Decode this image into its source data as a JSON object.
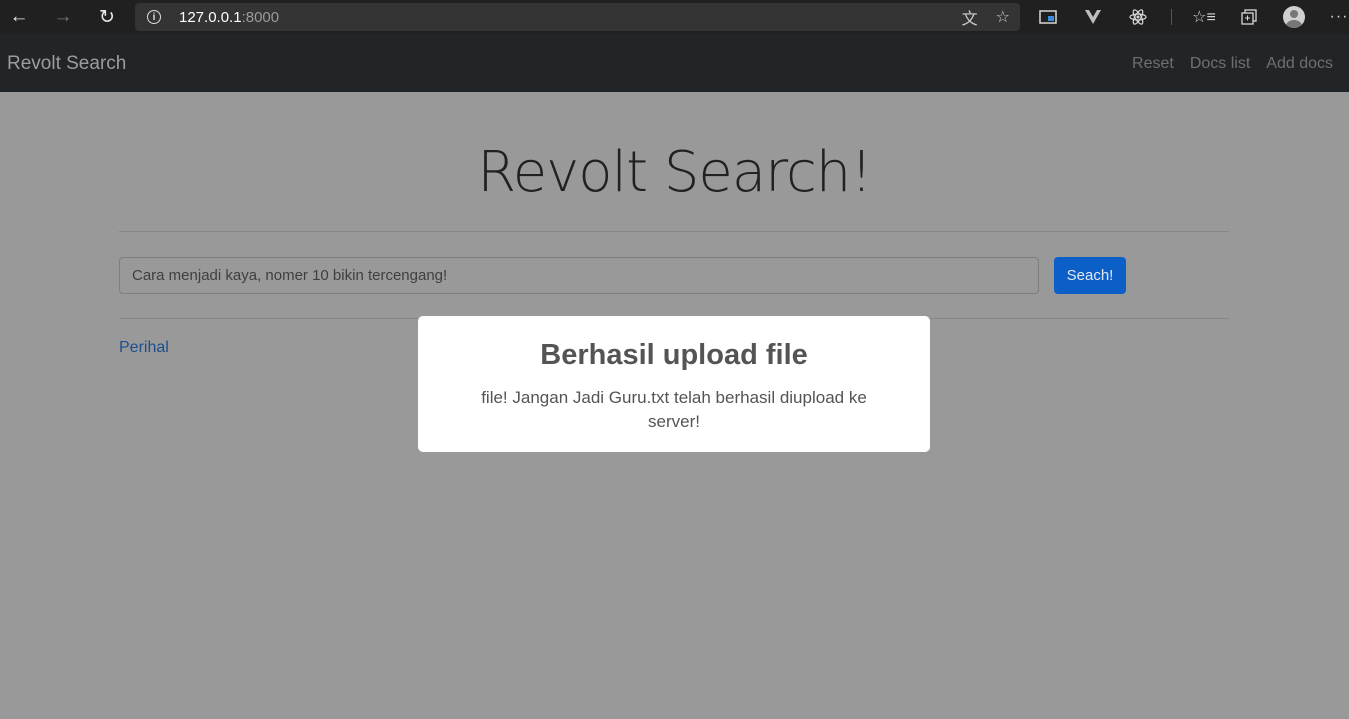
{
  "browser": {
    "url_host": "127.0.0.1",
    "url_port": ":8000",
    "icons": [
      "back-icon",
      "forward-icon",
      "reload-icon",
      "site-info-icon",
      "translate-icon",
      "favorite-star-icon",
      "extension-screen-icon",
      "vue-devtools-icon",
      "react-devtools-icon",
      "favorites-icon",
      "collections-icon",
      "profile-avatar",
      "more-menu-icon"
    ]
  },
  "navbar": {
    "brand": "Revolt Search",
    "links": [
      "Reset",
      "Docs list",
      "Add docs"
    ]
  },
  "main": {
    "title": "Revolt Search!",
    "search_value": "Cara menjadi kaya, nomer 10 bikin tercengang!",
    "search_button": "Seach!",
    "perihal_link": "Perihal"
  },
  "modal": {
    "title": "Berhasil upload file",
    "message": "file! Jangan Jadi Guru.txt telah berhasil diupload ke server!"
  },
  "colors": {
    "backdrop": "#999999",
    "navbar_bg": "#222527",
    "primary_button": "#0d5fc8",
    "link": "#1d4f8d"
  }
}
